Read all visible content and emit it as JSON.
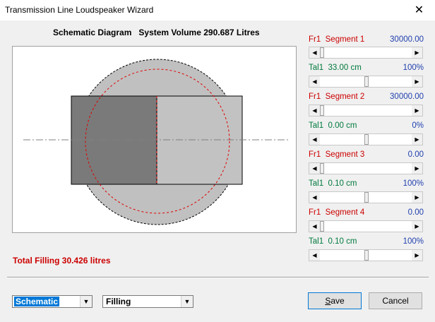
{
  "window": {
    "title": "Transmission Line Loudspeaker Wizard",
    "close_glyph": "✕"
  },
  "header": {
    "label": "Schematic Diagram",
    "volume": "System Volume 290.687 Litres"
  },
  "total_filling": "Total Filling  30.426 litres",
  "segments": [
    {
      "fr_label": "Fr1  Segment 1",
      "fr_value": "30000.00",
      "fr_level": 0.0,
      "tal_label": "Tal1  33.00 cm",
      "tal_value": "100%",
      "tal_level": 0.6
    },
    {
      "fr_label": "Fr1  Segment 2",
      "fr_value": "30000.00",
      "fr_level": 0.0,
      "tal_label": "Tal1  0.00 cm",
      "tal_value": "0%",
      "tal_level": 0.6
    },
    {
      "fr_label": "Fr1  Segment 3",
      "fr_value": "0.00",
      "fr_level": 0.0,
      "tal_label": "Tal1  0.10 cm",
      "tal_value": "100%",
      "tal_level": 0.6
    },
    {
      "fr_label": "Fr1  Segment 4",
      "fr_value": "0.00",
      "fr_level": 0.0,
      "tal_label": "Tal1  0.10 cm",
      "tal_value": "100%",
      "tal_level": 0.6
    }
  ],
  "view_select": {
    "value": "Schematic"
  },
  "mode_select": {
    "value": "Filling"
  },
  "buttons": {
    "save": "Save",
    "cancel": "Cancel"
  },
  "colors": {
    "red": "#cc0000",
    "blue": "#1f3fae",
    "green": "#007a3d",
    "selection": "#0078d7"
  },
  "icons": {
    "left_arrow": "◀",
    "right_arrow": "▶",
    "dropdown": "▼"
  }
}
